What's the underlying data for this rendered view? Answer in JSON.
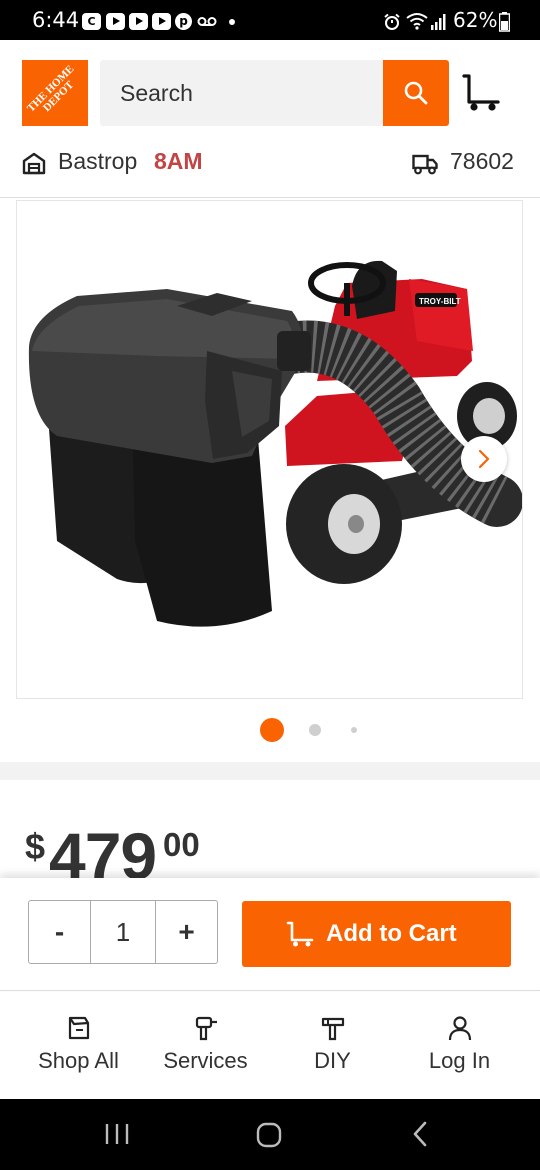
{
  "status_bar": {
    "time": "6:44",
    "battery": "62%",
    "app_icons": [
      "c-icon",
      "youtube-icon",
      "youtube-icon",
      "youtube-icon",
      "pinterest-icon",
      "voicemail-icon"
    ],
    "status_icons": [
      "alarm-icon",
      "wifi-icon",
      "signal-icon",
      "battery-icon"
    ]
  },
  "header": {
    "logo_text": "THE HOME DEPOT",
    "search_placeholder": "Search",
    "brand_color": "#f96302"
  },
  "store": {
    "name": "Bastrop",
    "open_time": "8AM",
    "zip": "78602"
  },
  "product": {
    "image_alt": "Two-bin bagger attached to red riding lawn mower",
    "mower_brand_text": "TROY-BILT",
    "carousel": {
      "active_index": 0,
      "dot_count": 3
    },
    "price": {
      "currency": "$",
      "dollars": "479",
      "cents": "00"
    }
  },
  "buy_bar": {
    "minus_label": "-",
    "quantity": "1",
    "plus_label": "+",
    "add_to_cart_label": "Add to Cart"
  },
  "bottom_nav": {
    "items": [
      {
        "label": "Shop All",
        "icon": "shop-all-icon"
      },
      {
        "label": "Services",
        "icon": "services-icon"
      },
      {
        "label": "DIY",
        "icon": "diy-icon"
      },
      {
        "label": "Log In",
        "icon": "user-icon"
      }
    ]
  },
  "system_nav": {
    "buttons": [
      "recent-apps-icon",
      "home-icon",
      "back-icon"
    ]
  }
}
